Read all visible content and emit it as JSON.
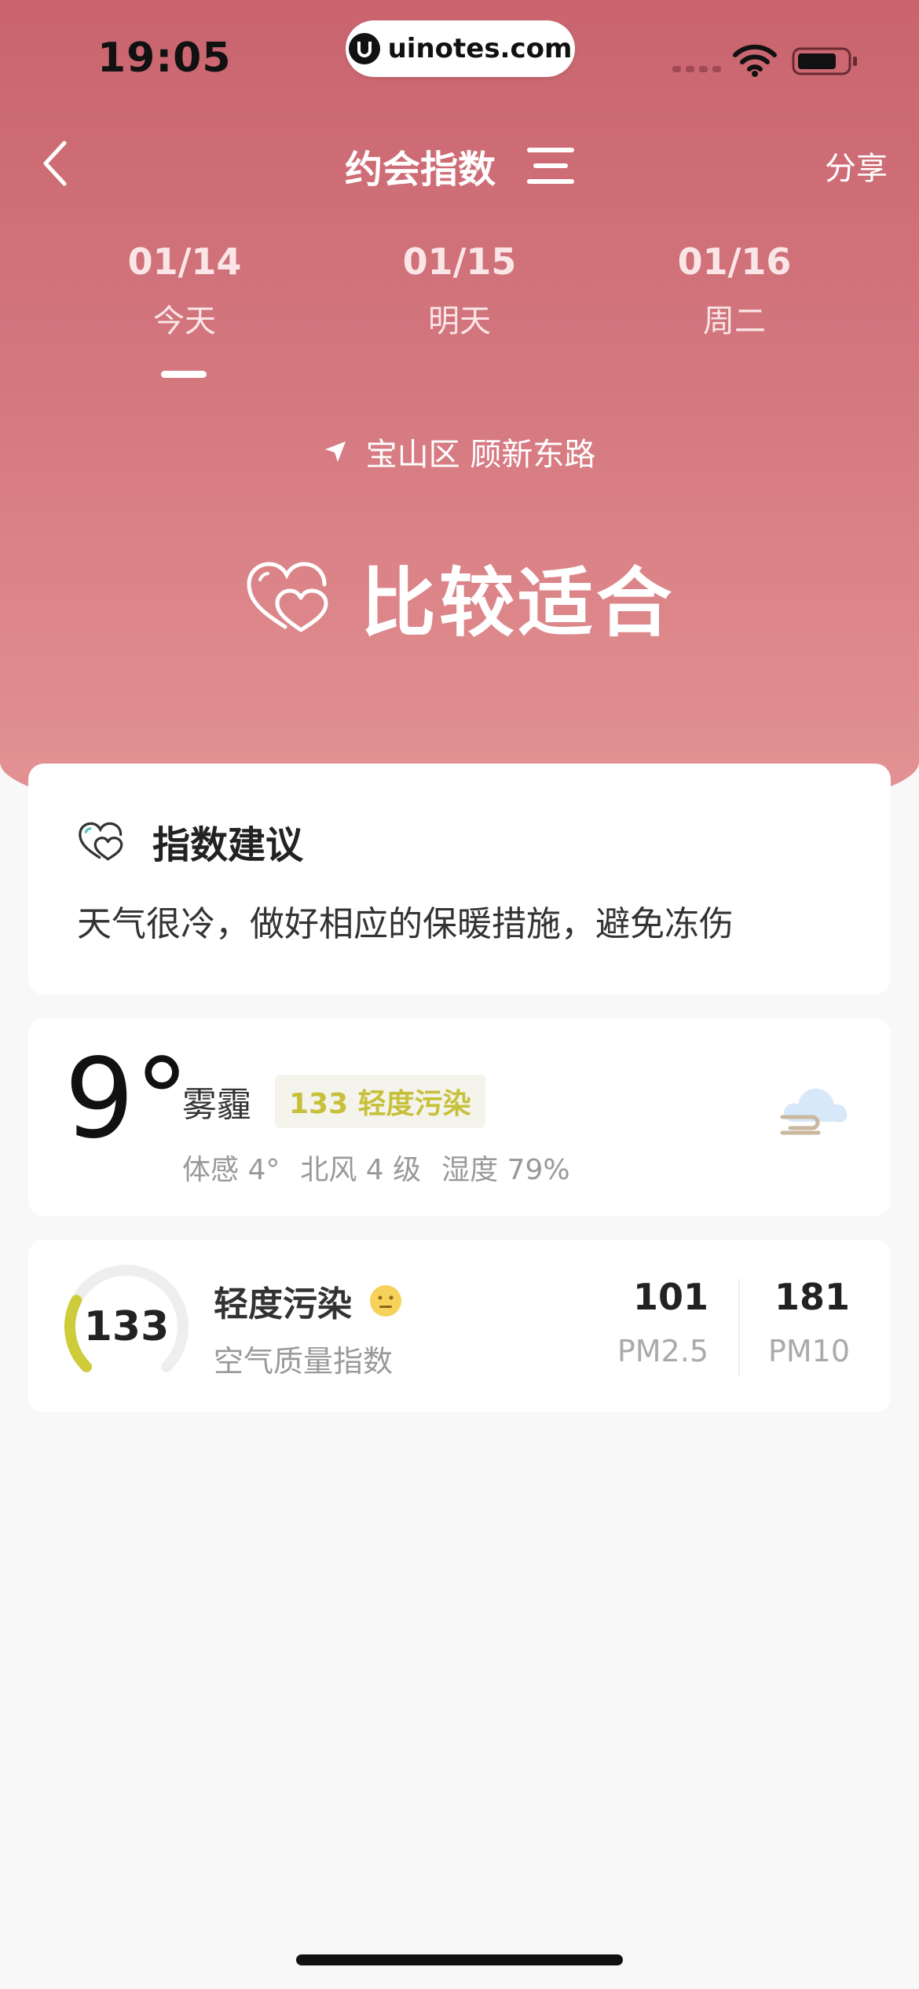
{
  "status_bar": {
    "time": "19:05",
    "url": "uinotes.com"
  },
  "nav": {
    "title": "约会指数",
    "share_label": "分享"
  },
  "date_tabs": [
    {
      "date": "01/14",
      "day": "今天",
      "selected": true
    },
    {
      "date": "01/15",
      "day": "明天",
      "selected": false
    },
    {
      "date": "01/16",
      "day": "周二",
      "selected": false
    }
  ],
  "location": "宝山区 顾新东路",
  "verdict": "比较适合",
  "advice": {
    "title": "指数建议",
    "text": "天气很冷，做好相应的保暖措施，避免冻伤"
  },
  "weather": {
    "temperature": "9°",
    "condition": "雾霾",
    "aqi_badge": "133 轻度污染",
    "feels_like": "体感 4°",
    "wind": "北风 4 级",
    "humidity": "湿度 79%"
  },
  "aqi": {
    "value": "133",
    "gauge_fraction": 0.27,
    "level": "轻度污染",
    "label": "空气质量指数",
    "pm25_value": "101",
    "pm25_label": "PM2.5",
    "pm10_value": "181",
    "pm10_label": "PM10"
  },
  "colors": {
    "hero_top": "#c9646e",
    "hero_bottom": "#e49494",
    "aqi_yellow": "#c7c03a",
    "gauge_track": "#eeeeee"
  }
}
